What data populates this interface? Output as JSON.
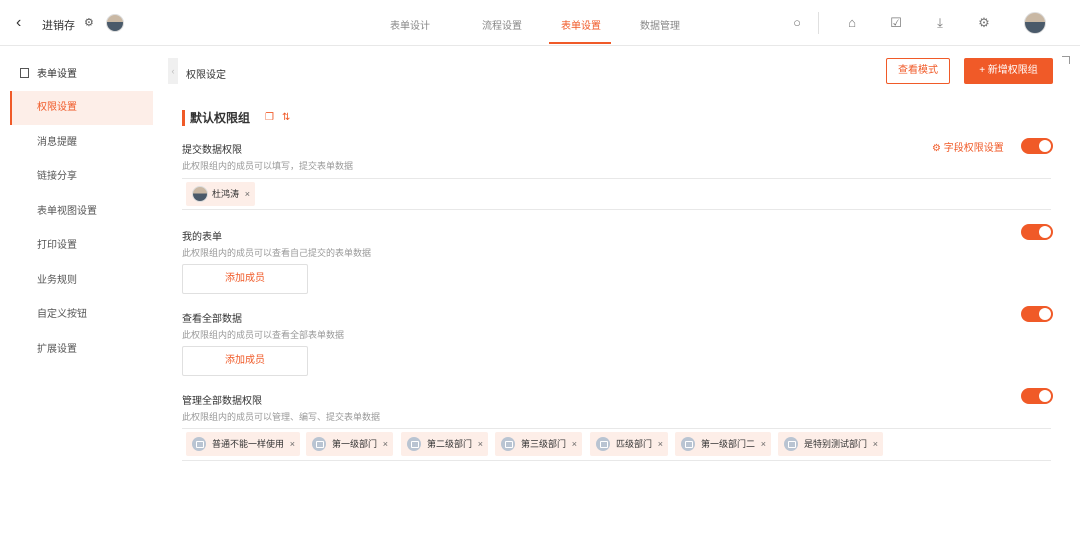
{
  "header": {
    "back_icon": "chevron-left-icon",
    "app_title": "进销存",
    "tabs": [
      {
        "label": "表单设计",
        "active": false
      },
      {
        "label": "流程设置",
        "active": false
      },
      {
        "label": "表单设置",
        "active": true
      },
      {
        "label": "数据管理",
        "active": false
      }
    ],
    "tools": [
      "search-icon",
      "home-icon",
      "shirt-icon",
      "download-icon",
      "settings-icon"
    ]
  },
  "sidebar": {
    "heading": "表单设置",
    "items": [
      {
        "label": "权限设置",
        "active": true
      },
      {
        "label": "消息提醒",
        "active": false
      },
      {
        "label": "链接分享",
        "active": false
      },
      {
        "label": "表单视图设置",
        "active": false
      },
      {
        "label": "打印设置",
        "active": false
      },
      {
        "label": "业务规则",
        "active": false
      },
      {
        "label": "自定义按钮",
        "active": false
      },
      {
        "label": "扩展设置",
        "active": false
      }
    ]
  },
  "content": {
    "page_title": "权限设定",
    "preview_button": "查看模式",
    "add_group_button": "+ 新增权限组",
    "group": {
      "title": "默认权限组",
      "permissions": [
        {
          "title": "提交数据权限",
          "desc": "此权限组内的成员可以填写，提交表单数据",
          "enabled": true,
          "advanced": "字段权限设置",
          "members": [
            {
              "name": "杜鸿涛",
              "type": "user"
            }
          ]
        },
        {
          "title": "我的表单",
          "desc": "此权限组内的成员可以查看自己提交的表单数据",
          "enabled": true,
          "add_label": "添加成员"
        },
        {
          "title": "查看全部数据",
          "desc": "此权限组内的成员可以查看全部表单数据",
          "enabled": true,
          "add_label": "添加成员"
        },
        {
          "title": "管理全部数据权限",
          "desc": "此权限组内的成员可以管理、编写、提交表单数据",
          "enabled": true,
          "members": [
            {
              "name": "普通不能一样使用",
              "type": "dept"
            },
            {
              "name": "第一级部门",
              "type": "dept"
            },
            {
              "name": "第二级部门",
              "type": "dept"
            },
            {
              "name": "第三级部门",
              "type": "dept"
            },
            {
              "name": "匹级部门",
              "type": "dept"
            },
            {
              "name": "第一级部门二",
              "type": "dept"
            },
            {
              "name": "是特别测试部门",
              "type": "dept"
            }
          ]
        }
      ]
    }
  },
  "accent_color": "#f05a28"
}
